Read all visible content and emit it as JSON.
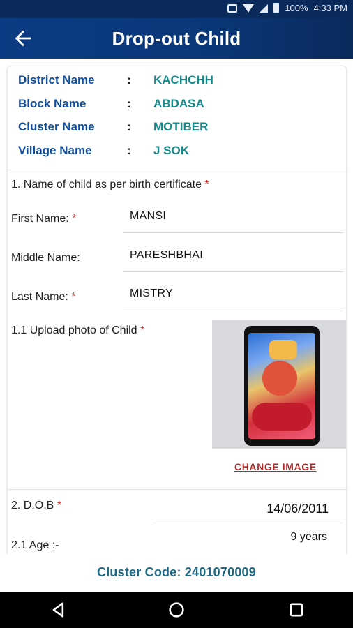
{
  "status_bar": {
    "battery": "100%",
    "time": "4:33 PM",
    "icons": [
      "vibrate-icon",
      "wifi-icon",
      "signal-icon",
      "battery-icon"
    ]
  },
  "app_bar": {
    "title": "Drop-out Child",
    "back_icon": "arrow-left-icon"
  },
  "location": {
    "district": {
      "label": "District Name",
      "value": "KACHCHH"
    },
    "block": {
      "label": "Block Name",
      "value": "ABDASA"
    },
    "cluster": {
      "label": "Cluster Name",
      "value": "MOTIBER"
    },
    "village": {
      "label": "Village Name",
      "value": "J SOK"
    },
    "separator": ":"
  },
  "form": {
    "q1": {
      "label": "1. Name of child as per birth certificate",
      "required": "*"
    },
    "first_name": {
      "label": "First Name:",
      "required": "*",
      "value": "MANSI"
    },
    "middle_name": {
      "label": "Middle Name:",
      "value": "PARESHBHAI"
    },
    "last_name": {
      "label": "Last Name:",
      "required": "*",
      "value": "MISTRY"
    },
    "photo": {
      "label": "1.1 Upload photo of Child",
      "required": "*",
      "change_label": "CHANGE IMAGE"
    },
    "dob": {
      "label": "2. D.O.B",
      "required": "*",
      "value": "14/06/2011"
    },
    "age": {
      "label": "2.1 Age :-",
      "value": "9 years"
    }
  },
  "footer": {
    "cluster_code_label": "Cluster Code: 2401070009"
  },
  "nav_bar": {
    "buttons": [
      "back-triangle-icon",
      "home-circle-icon",
      "recents-square-icon"
    ]
  },
  "colors": {
    "app_bar": "#0c3b83",
    "label_blue": "#114e9d",
    "value_teal": "#168a8a",
    "required_red": "#d32f2f",
    "link_red": "#b22b2b",
    "footer_text": "#1c6a86"
  }
}
